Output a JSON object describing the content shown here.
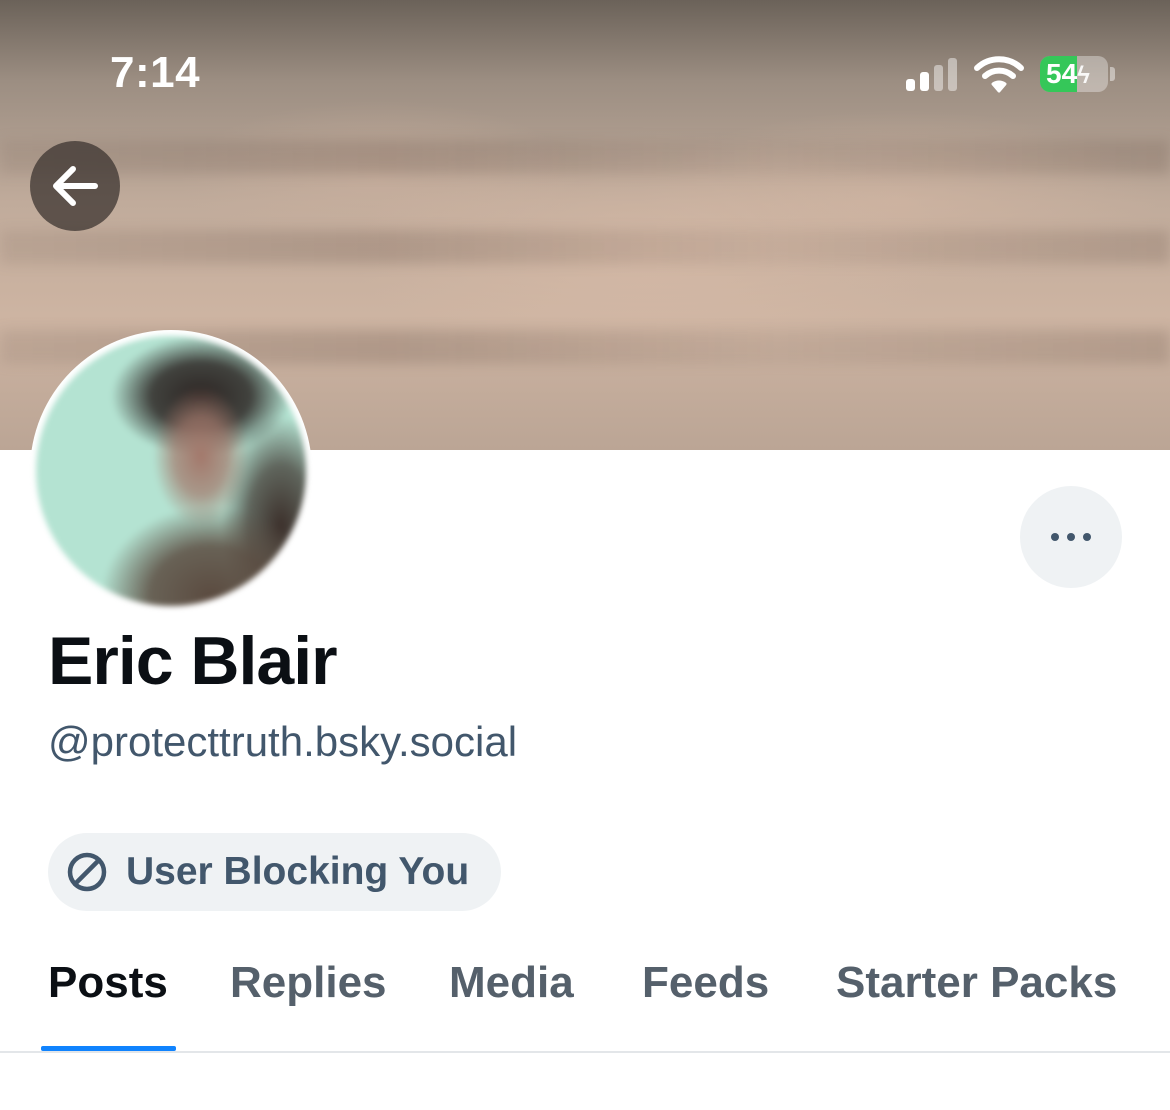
{
  "status_bar": {
    "time": "7:14",
    "battery_level": "54",
    "battery_color": "#35c759"
  },
  "header": {
    "back_icon": "arrow-left-icon",
    "more_icon": "ellipsis-icon"
  },
  "profile": {
    "display_name": "Eric Blair",
    "handle": "@protecttruth.bsky.social",
    "block_status": {
      "icon": "block-icon",
      "label": "User Blocking You"
    }
  },
  "tabs": [
    {
      "label": "Posts",
      "active": true
    },
    {
      "label": "Replies",
      "active": false
    },
    {
      "label": "Media",
      "active": false
    },
    {
      "label": "Feeds",
      "active": false
    },
    {
      "label": "Starter Packs",
      "active": false
    }
  ],
  "colors": {
    "accent": "#1083fe",
    "text_primary": "#0b0f14",
    "text_secondary": "#42576c",
    "pill_bg": "#eff2f4"
  }
}
